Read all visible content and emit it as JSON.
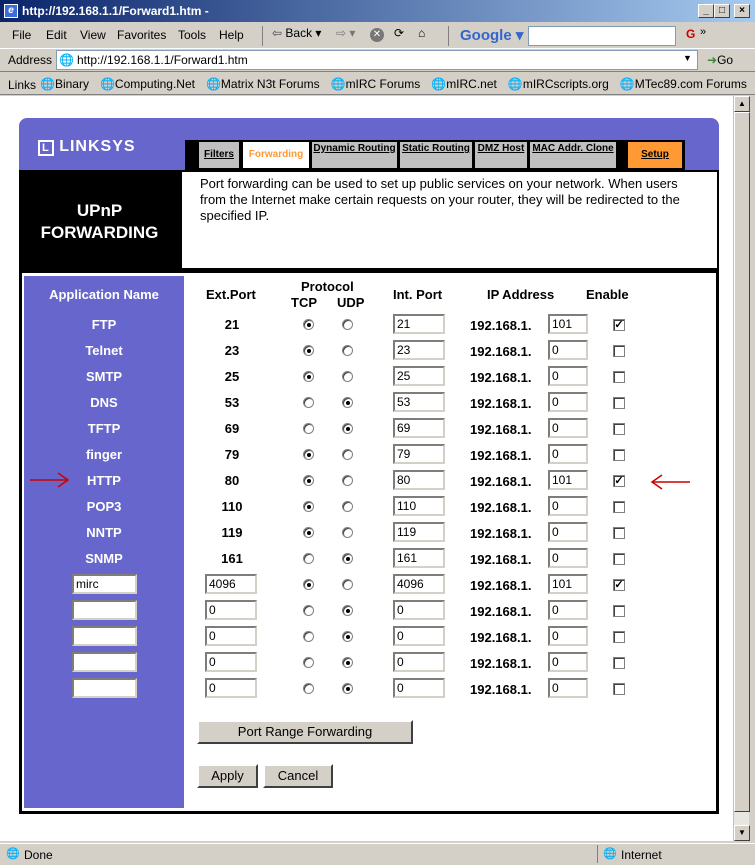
{
  "window": {
    "title": "http://192.168.1.1/Forward1.htm -"
  },
  "menu": [
    "File",
    "Edit",
    "View",
    "Favorites",
    "Tools",
    "Help"
  ],
  "toolbar": {
    "back": "Back",
    "google": "Google"
  },
  "address": {
    "label": "Address",
    "url": "http://192.168.1.1/Forward1.htm",
    "go": "Go"
  },
  "links": {
    "label": "Links",
    "items": [
      "Binary",
      "Computing.Net",
      "Matrix N3t Forums",
      "mIRC Forums",
      "mIRC.net",
      "mIRCscripts.org",
      "MTec89.com Forums"
    ]
  },
  "brand": {
    "logo": "LINKSYS"
  },
  "tabs": [
    {
      "label": "Filters"
    },
    {
      "label": "Forwarding"
    },
    {
      "label": "Dynamic Routing"
    },
    {
      "label": "Static Routing"
    },
    {
      "label": "DMZ Host"
    },
    {
      "label": "MAC Addr. Clone"
    },
    {
      "label": "Setup"
    }
  ],
  "section": {
    "title_line1": "UPnP",
    "title_line2": "FORWARDING",
    "description": "Port forwarding can be used to set up public services on your network. When users from the Internet make certain requests on your router, they will be redirected to the specified IP."
  },
  "table": {
    "headers": {
      "app": "Application Name",
      "ext": "Ext.Port",
      "protocol": "Protocol",
      "tcp": "TCP",
      "udp": "UDP",
      "int": "Int. Port",
      "ip": "IP Address",
      "enable": "Enable"
    },
    "ip_prefix": "192.168.1.",
    "rows": [
      {
        "name": "FTP",
        "ext": "21",
        "proto": "TCP",
        "int": "21",
        "ip": "101",
        "enabled": true
      },
      {
        "name": "Telnet",
        "ext": "23",
        "proto": "TCP",
        "int": "23",
        "ip": "0",
        "enabled": false
      },
      {
        "name": "SMTP",
        "ext": "25",
        "proto": "TCP",
        "int": "25",
        "ip": "0",
        "enabled": false
      },
      {
        "name": "DNS",
        "ext": "53",
        "proto": "UDP",
        "int": "53",
        "ip": "0",
        "enabled": false
      },
      {
        "name": "TFTP",
        "ext": "69",
        "proto": "UDP",
        "int": "69",
        "ip": "0",
        "enabled": false
      },
      {
        "name": "finger",
        "ext": "79",
        "proto": "TCP",
        "int": "79",
        "ip": "0",
        "enabled": false
      },
      {
        "name": "HTTP",
        "ext": "80",
        "proto": "TCP",
        "int": "80",
        "ip": "101",
        "enabled": true
      },
      {
        "name": "POP3",
        "ext": "110",
        "proto": "TCP",
        "int": "110",
        "ip": "0",
        "enabled": false
      },
      {
        "name": "NNTP",
        "ext": "119",
        "proto": "TCP",
        "int": "119",
        "ip": "0",
        "enabled": false
      },
      {
        "name": "SNMP",
        "ext": "161",
        "proto": "UDP",
        "int": "161",
        "ip": "0",
        "enabled": false
      },
      {
        "name": "mirc",
        "custom": true,
        "ext": "4096",
        "proto": "TCP",
        "int": "4096",
        "ip": "101",
        "enabled": true
      },
      {
        "name": "",
        "custom": true,
        "ext": "0",
        "proto": "UDP",
        "int": "0",
        "ip": "0",
        "enabled": false
      },
      {
        "name": "",
        "custom": true,
        "ext": "0",
        "proto": "UDP",
        "int": "0",
        "ip": "0",
        "enabled": false
      },
      {
        "name": "",
        "custom": true,
        "ext": "0",
        "proto": "UDP",
        "int": "0",
        "ip": "0",
        "enabled": false
      },
      {
        "name": "",
        "custom": true,
        "ext": "0",
        "proto": "UDP",
        "int": "0",
        "ip": "0",
        "enabled": false
      }
    ]
  },
  "buttons": {
    "port_range": "Port Range Forwarding",
    "apply": "Apply",
    "cancel": "Cancel"
  },
  "status": {
    "left": "Done",
    "zone": "Internet"
  }
}
